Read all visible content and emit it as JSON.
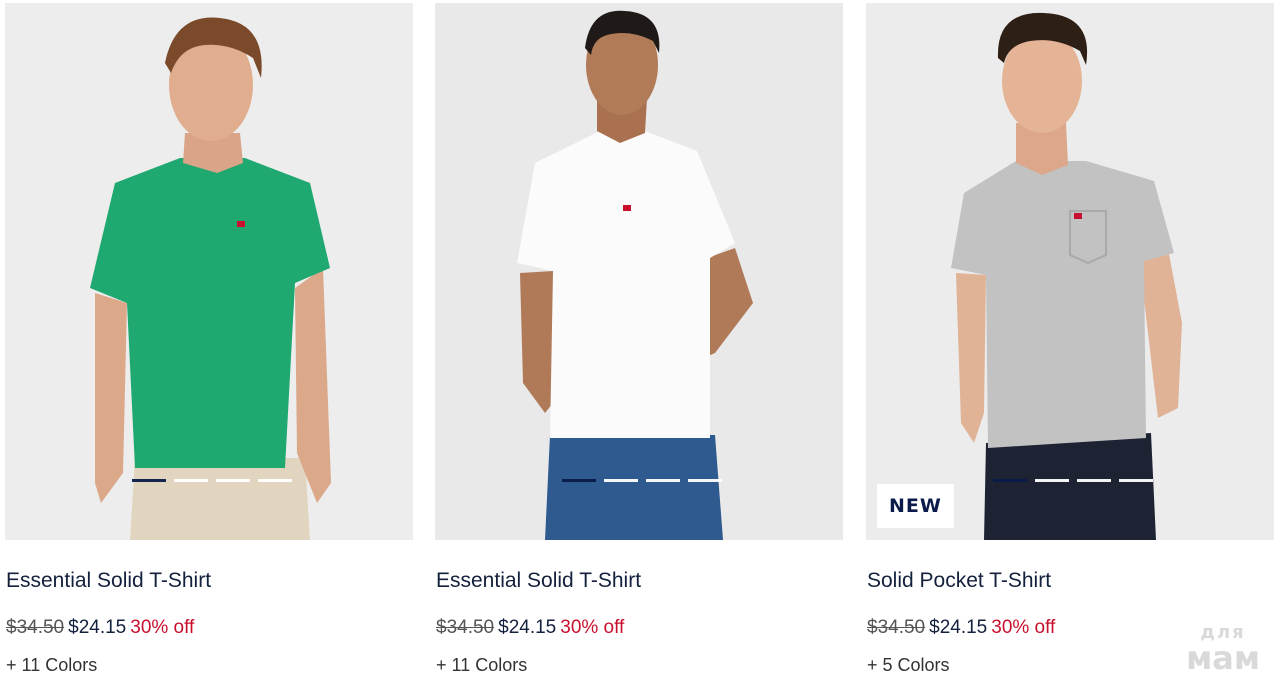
{
  "products": [
    {
      "name": "Essential Solid T-Shirt",
      "original_price": "$34.50",
      "sale_price": "$24.15",
      "discount": "30% off",
      "colors": "+ 11 Colors",
      "badge": "",
      "shirt_color": "#1fa870",
      "image_icon": "green-tshirt-model-image"
    },
    {
      "name": "Essential Solid T-Shirt",
      "original_price": "$34.50",
      "sale_price": "$24.15",
      "discount": "30% off",
      "colors": "+ 11 Colors",
      "badge": "",
      "shirt_color": "#fdfdfd",
      "image_icon": "white-tshirt-model-image"
    },
    {
      "name": "Solid Pocket T-Shirt",
      "original_price": "$34.50",
      "sale_price": "$24.15",
      "discount": "30% off",
      "colors": "+ 5 Colors",
      "badge": "NEW",
      "shirt_color": "#c2c2c2",
      "image_icon": "gray-pocket-tshirt-model-image"
    }
  ],
  "watermark": {
    "line1": "для",
    "line2": "мам"
  },
  "theme": {
    "navy": "#14213d",
    "sale_red": "#c8102e",
    "image_bg": "#eeeeee"
  }
}
